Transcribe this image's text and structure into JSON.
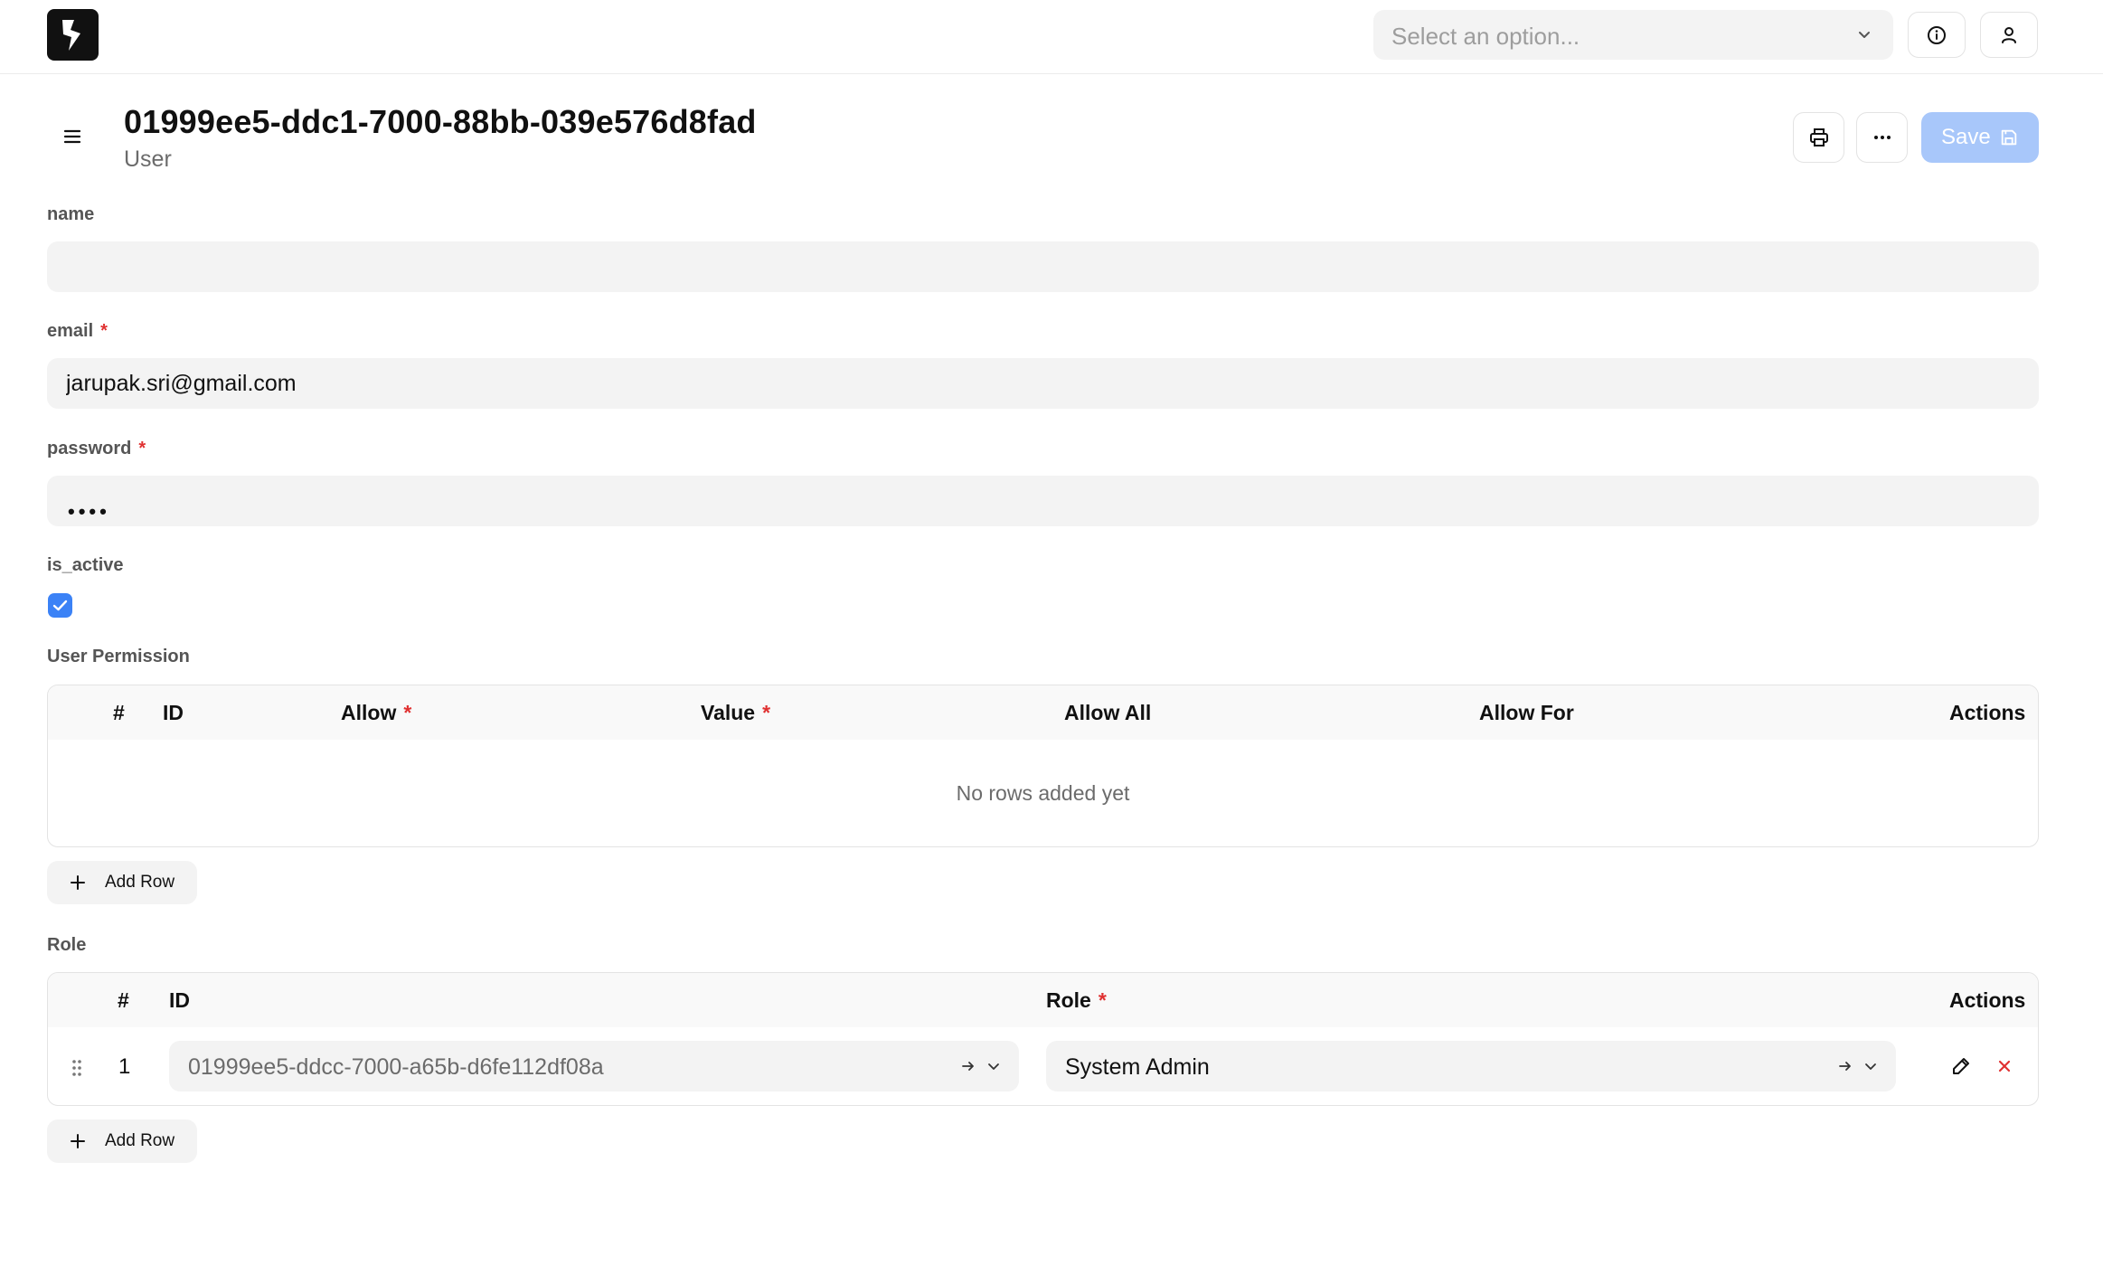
{
  "topbar": {
    "search_placeholder": "Select an option...",
    "icons": [
      "logo-icon",
      "chevron-down-icon",
      "info-icon",
      "user-icon"
    ]
  },
  "header": {
    "title": "01999ee5-ddc1-7000-88bb-039e576d8fad",
    "subtitle": "User",
    "save_label": "Save",
    "icons": [
      "menu-icon",
      "printer-icon",
      "more-icon",
      "save-icon"
    ]
  },
  "form": {
    "name": {
      "label": "name",
      "value": ""
    },
    "email": {
      "label": "email",
      "required_mark": "*",
      "value": "jarupak.sri@gmail.com"
    },
    "password": {
      "label": "password",
      "required_mark": "*",
      "masked_value": "••••"
    },
    "is_active": {
      "label": "is_active",
      "checked": true
    }
  },
  "user_permission": {
    "label": "User Permission",
    "columns": [
      "#",
      "ID",
      "Allow",
      "Value",
      "Allow All",
      "Allow For",
      "Actions"
    ],
    "required_mark": "*",
    "empty_message": "No rows added yet",
    "add_row_label": "Add Row"
  },
  "role": {
    "label": "Role",
    "columns": [
      "#",
      "ID",
      "Role",
      "Actions"
    ],
    "required_mark": "*",
    "rows": [
      {
        "index": "1",
        "id": "01999ee5-ddcc-7000-a65b-d6fe112df08a",
        "role": "System Admin"
      }
    ],
    "add_row_label": "Add Row"
  },
  "colors": {
    "accent": "#3b82f6",
    "save_disabled": "#a8c7fa",
    "required": "#e03131",
    "input_bg": "#f3f3f3"
  }
}
